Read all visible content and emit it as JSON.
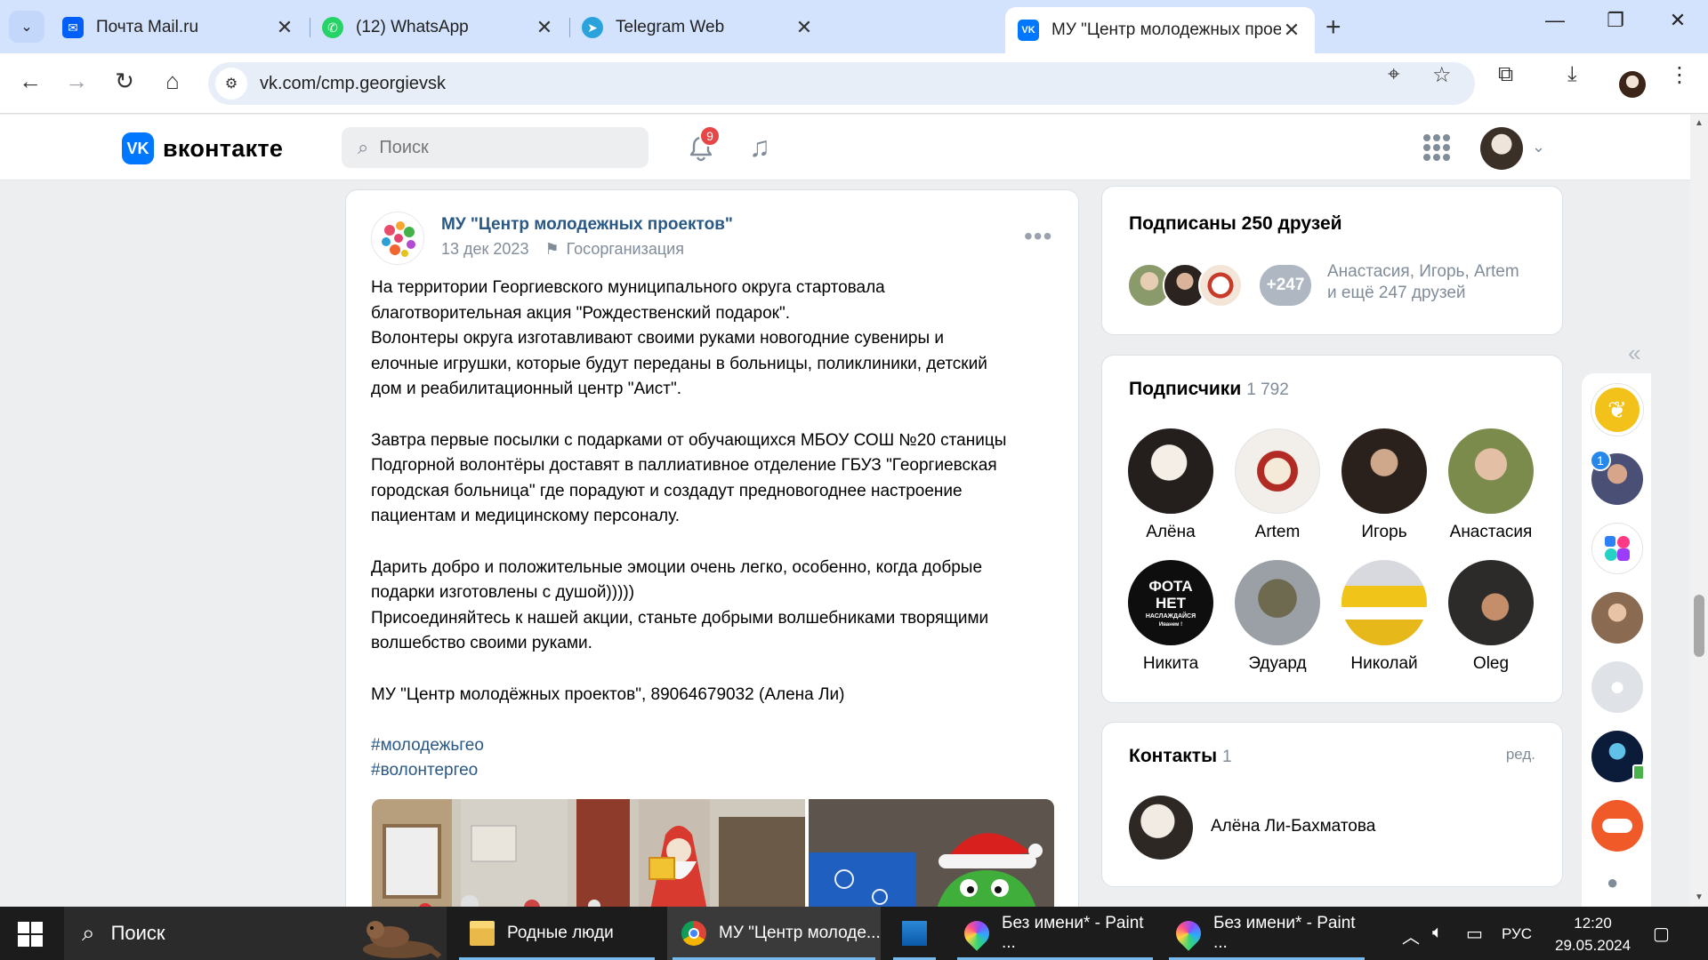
{
  "browser": {
    "tabs": [
      {
        "title": "Почта Mail.ru",
        "icon": "mail-ru-icon"
      },
      {
        "title": "(12) WhatsApp",
        "icon": "whatsapp-icon"
      },
      {
        "title": "Telegram Web",
        "icon": "telegram-icon"
      },
      {
        "title": "МУ \"Центр молодежных прое",
        "icon": "vk-icon",
        "active": true
      }
    ],
    "close_glyph": "✕",
    "new_tab_glyph": "+",
    "url": "vk.com/cmp.georgievsk"
  },
  "vk": {
    "logo_text": "вконтакте",
    "logo_letter": "VK",
    "search_placeholder": "Поиск",
    "notifications_count": "9",
    "accent_color": "#0077ff"
  },
  "post": {
    "author": "МУ \"Центр молодежных проектов\"",
    "date": "13 дек 2023",
    "category": "Госорганизация",
    "paragraphs": [
      "На территории Георгиевского муниципального округа стартовала\nблаготворительная акция \"Рождественский подарок\".\nВолонтеры округа изготавливают своими руками новогодние сувениры и\nелочные игрушки, которые будут переданы в больницы, поликлиники, детский\nдом и реабилитационный центр \"Аист\".",
      "Завтра первые посылки с подарками от обучающихся МБОУ СОШ №20 станицы\nПодгорной волонтёры доставят в паллиативное отделение ГБУЗ \"Георгиевская\nгородская больница\" где порадуют и создадут предновогоднее настроение\nпациентам и медицинскому персоналу.",
      "Дарить добро и положительные эмоции очень легко, особенно, когда добрые\nподарки изготовлены с душой)))))\nПрисоединяйтесь к нашей акции, станьте добрыми волшебниками творящими\nволшебство своими руками.",
      "МУ \"Центр молодёжных проектов\", 89064679032 (Алена Ли)"
    ],
    "tags": [
      "#молодежьгео",
      "#волонтергео"
    ]
  },
  "friends_card": {
    "title": "Подписаны 250 друзей",
    "more_badge": "+247",
    "names_line1": "Анастасия, Игорь, Artem",
    "names_line2": "и ещё 247 друзей"
  },
  "subscribers_card": {
    "title": "Подписчики",
    "count": "1 792",
    "people": [
      "Алёна",
      "Artem",
      "Игорь",
      "Анастасия",
      "Никита",
      "Эдуард",
      "Николай",
      "Oleg"
    ],
    "nikita_avatar_text": [
      "ФОТА",
      "НЕТ",
      "НАСЛАЖДАЙСЯ",
      "Иванем !"
    ]
  },
  "contacts_card": {
    "title": "Контакты",
    "count": "1",
    "edit_label": "ред.",
    "contact_name": "Алёна Ли-Бахматова"
  },
  "sidebar": {
    "collapse_glyph": "«",
    "badge": "1"
  },
  "taskbar": {
    "search_label": "Поиск",
    "apps": [
      {
        "label": "Родные люди",
        "icon": "folder-icon"
      },
      {
        "label": "МУ \"Центр молоде...",
        "icon": "chrome-icon",
        "active": true
      },
      {
        "label": "",
        "icon": "app-icon"
      },
      {
        "label": "Без имени* - Paint ...",
        "icon": "paint-icon"
      },
      {
        "label": "Без имени* - Paint ...",
        "icon": "paint-icon"
      }
    ],
    "language": "РУС",
    "time": "12:20",
    "date": "29.05.2024"
  }
}
